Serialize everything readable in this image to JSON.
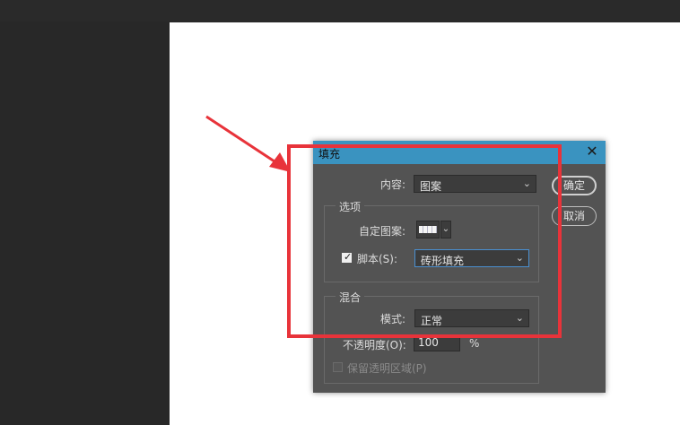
{
  "dialog": {
    "title": "填充",
    "close_glyph": "✕",
    "content_label": "内容:",
    "content_value": "图案",
    "ok_label": "确定",
    "cancel_label": "取消"
  },
  "options": {
    "group_title": "选项",
    "custom_pattern_label": "自定图案:",
    "script_label": "脚本(S):",
    "script_checked": true,
    "script_value": "砖形填充"
  },
  "blending": {
    "group_title": "混合",
    "mode_label": "模式:",
    "mode_value": "正常",
    "opacity_label": "不透明度(O):",
    "opacity_value": "100",
    "opacity_unit": "%",
    "preserve_label": "保留透明区域(P)"
  },
  "colors": {
    "titlebar": "#3a93c0",
    "dialog_bg": "#535353",
    "annotation_red": "#e8333a"
  },
  "icons": {
    "close": "close-icon",
    "chevron": "chevron-down-icon",
    "check": "check-icon",
    "annotation_arrow": "arrow-annotation-icon"
  }
}
